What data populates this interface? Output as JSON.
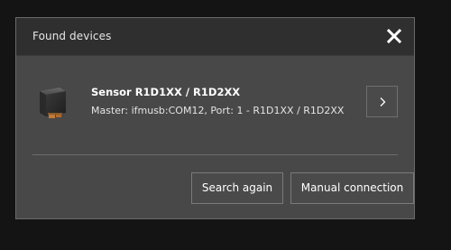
{
  "dialog": {
    "title": "Found devices",
    "close_icon": "close-icon"
  },
  "device": {
    "name": "Sensor R1D1XX / R1D2XX",
    "detail": "Master: ifmusb:COM12, Port: 1 - R1D1XX / R1D2XX",
    "icon": "sensor-device-icon",
    "open_icon": "chevron-right-icon"
  },
  "actions": {
    "search_again_label": "Search again",
    "manual_connection_label": "Manual connection"
  },
  "colors": {
    "page_background": "#141414",
    "dialog_background": "#484848",
    "header_background": "#2f2f2f",
    "text": "#ffffff"
  }
}
